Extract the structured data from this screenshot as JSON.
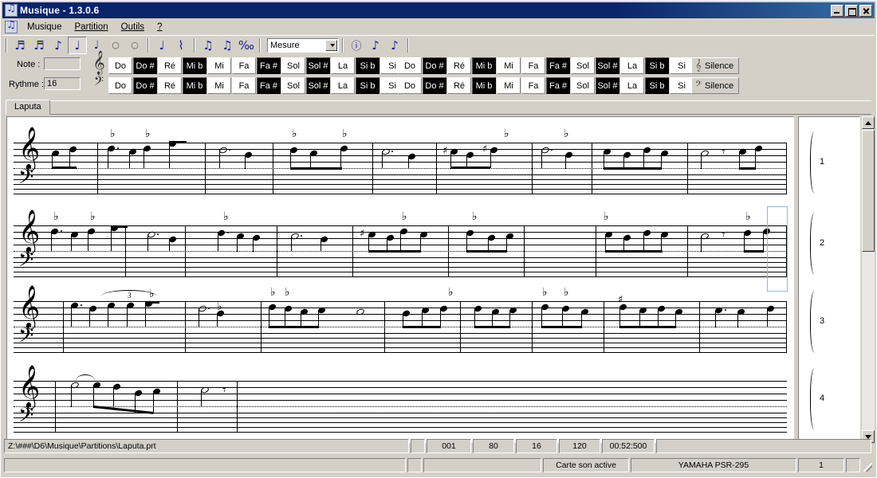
{
  "window": {
    "title": "Musique - 1.3.0.6",
    "app_icon": "music-note-icon",
    "minimize_label": "_",
    "maximize_label": "□",
    "close_label": "×"
  },
  "menubar": {
    "icon": "music-note-icon",
    "items": [
      {
        "label": "Musique"
      },
      {
        "label": "Partition"
      },
      {
        "label": "Outils"
      },
      {
        "label": "?"
      }
    ]
  },
  "toolbar": {
    "note_tools": [
      {
        "name": "sixteenth-note-tool",
        "glyph": "♬",
        "selected": false
      },
      {
        "name": "sixteenth-note-tool-2",
        "glyph": "♬",
        "selected": false
      },
      {
        "name": "eighth-note-tool",
        "glyph": "♪",
        "selected": false
      },
      {
        "name": "quarter-note-tool",
        "glyph": "♩",
        "selected": true
      },
      {
        "name": "half-note-tool",
        "glyph": "♩",
        "selected": false
      },
      {
        "name": "whole-note-tool",
        "glyph": "○",
        "selected": false
      },
      {
        "name": "breve-note-tool",
        "glyph": "○",
        "selected": false
      }
    ],
    "dotted_tools": [
      {
        "name": "dotted-note-tool",
        "glyph": "♩",
        "selected": false
      },
      {
        "name": "rest-tool",
        "glyph": "⌇",
        "selected": false
      }
    ],
    "articulation_tools": [
      {
        "name": "tie-tool",
        "glyph": "♫",
        "selected": false
      },
      {
        "name": "slur-tool",
        "glyph": "♫",
        "selected": false
      },
      {
        "name": "repeat-tool",
        "glyph": "‰",
        "selected": false
      }
    ],
    "combo": {
      "name": "measure-select",
      "value": "Mesure",
      "options": [
        "Mesure"
      ]
    },
    "right_tools": [
      {
        "name": "insert-text-tool",
        "glyph": "ⓘ"
      },
      {
        "name": "play-from-note-tool",
        "glyph": "♪"
      },
      {
        "name": "play-to-note-tool",
        "glyph": "♪"
      }
    ]
  },
  "note_panel": {
    "note_label": "Note :",
    "note_value": "",
    "rhythm_label": "Rythme :",
    "rhythm_value": "16",
    "treble_clef_glyph": "𝄞",
    "bass_clef_glyph": "𝄢",
    "octave_keys": [
      {
        "label": "Do",
        "black": false
      },
      {
        "label": "Do #",
        "black": true
      },
      {
        "label": "Ré",
        "black": false
      },
      {
        "label": "Mi b",
        "black": true
      },
      {
        "label": "Mi",
        "black": false
      },
      {
        "label": "Fa",
        "black": false
      },
      {
        "label": "Fa #",
        "black": true
      },
      {
        "label": "Sol",
        "black": false
      },
      {
        "label": "Sol #",
        "black": true
      },
      {
        "label": "La",
        "black": false
      },
      {
        "label": "Si b",
        "black": true
      },
      {
        "label": "Si",
        "black": false
      }
    ],
    "silence_treble_label": "Silence",
    "silence_bass_label": "Silence"
  },
  "tabs": {
    "items": [
      {
        "label": "Laputa",
        "active": true
      }
    ]
  },
  "score": {
    "systems": [
      {
        "number": "1"
      },
      {
        "number": "2"
      },
      {
        "number": "3"
      },
      {
        "number": "4"
      }
    ],
    "tuplet_label": "3",
    "cursor_color": "#8fb8dc"
  },
  "status_bar_1": {
    "file_path": "Z:\\###\\D6\\Musique\\Partitions\\Laputa.prt",
    "spacer": "",
    "measure": "001",
    "velocity": "80",
    "rhythm": "16",
    "tempo": "120",
    "time": "00:52:500",
    "trailer": ""
  },
  "status_bar_2": {
    "left": "",
    "spacer1": "",
    "spacer2": "",
    "sound_card": "Carte son active",
    "device": "YAMAHA PSR-295",
    "channel": "1",
    "trailer": ""
  },
  "scrollbar": {
    "up_arrow": "▲",
    "down_arrow": "▼"
  }
}
